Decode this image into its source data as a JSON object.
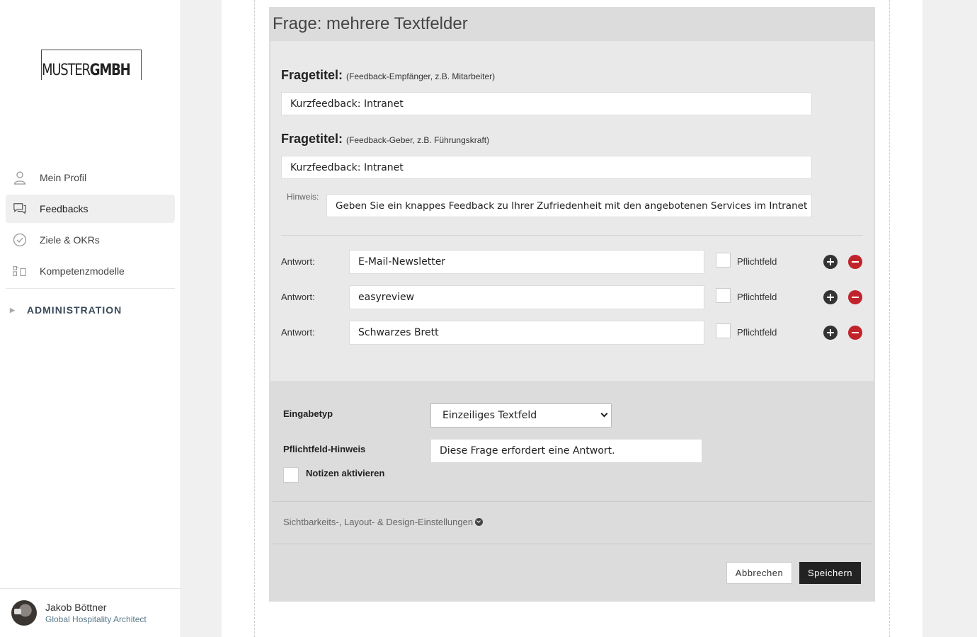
{
  "brand": {
    "logo_thin": "MUSTER",
    "logo_bold": "GMBH"
  },
  "sidebar": {
    "items": [
      {
        "label": "Mein Profil",
        "icon": "user-icon"
      },
      {
        "label": "Feedbacks",
        "icon": "chat-bubbles-icon",
        "active": true
      },
      {
        "label": "Ziele & OKRs",
        "icon": "check-circle-icon"
      },
      {
        "label": "Kompetenzmodelle",
        "icon": "blocks-icon"
      }
    ],
    "admin_label": "ADMINISTRATION"
  },
  "profile": {
    "name": "Jakob Böttner",
    "role": "Global Hospitality Architect"
  },
  "card": {
    "title": "Frage: mehrere Textfelder",
    "question_titles": [
      {
        "label": "Fragetitel:",
        "hint": "(Feedback-Empfänger, z.B. Mitarbeiter)",
        "value": "Kurzfeedback: Intranet"
      },
      {
        "label": "Fragetitel:",
        "hint": "(Feedback-Geber, z.B. Führungskraft)",
        "value": "Kurzfeedback: Intranet"
      }
    ],
    "hinweis": {
      "label": "Hinweis:",
      "value": "Geben Sie ein knappes Feedback zu Ihrer Zufriedenheit mit den angebotenen Services im Intranet"
    },
    "answers": [
      {
        "label": "Antwort:",
        "value": "E-Mail-Newsletter",
        "required_label": "Pflichtfeld"
      },
      {
        "label": "Antwort:",
        "value": "easyreview",
        "required_label": "Pflichtfeld"
      },
      {
        "label": "Antwort:",
        "value": "Schwarzes Brett",
        "required_label": "Pflichtfeld"
      }
    ],
    "settings": {
      "input_type_label": "Eingabetyp",
      "input_type_value": "Einzeiliges Textfeld",
      "required_hint_label": "Pflichtfeld-Hinweis",
      "required_hint_value": "Diese Frage erfordert eine Antwort.",
      "notes_label": "Notizen aktivieren"
    },
    "visibility_link": "Sichtbarkeits-, Layout- & Design-Einstellungen",
    "buttons": {
      "cancel": "Abbrechen",
      "save": "Speichern"
    }
  }
}
